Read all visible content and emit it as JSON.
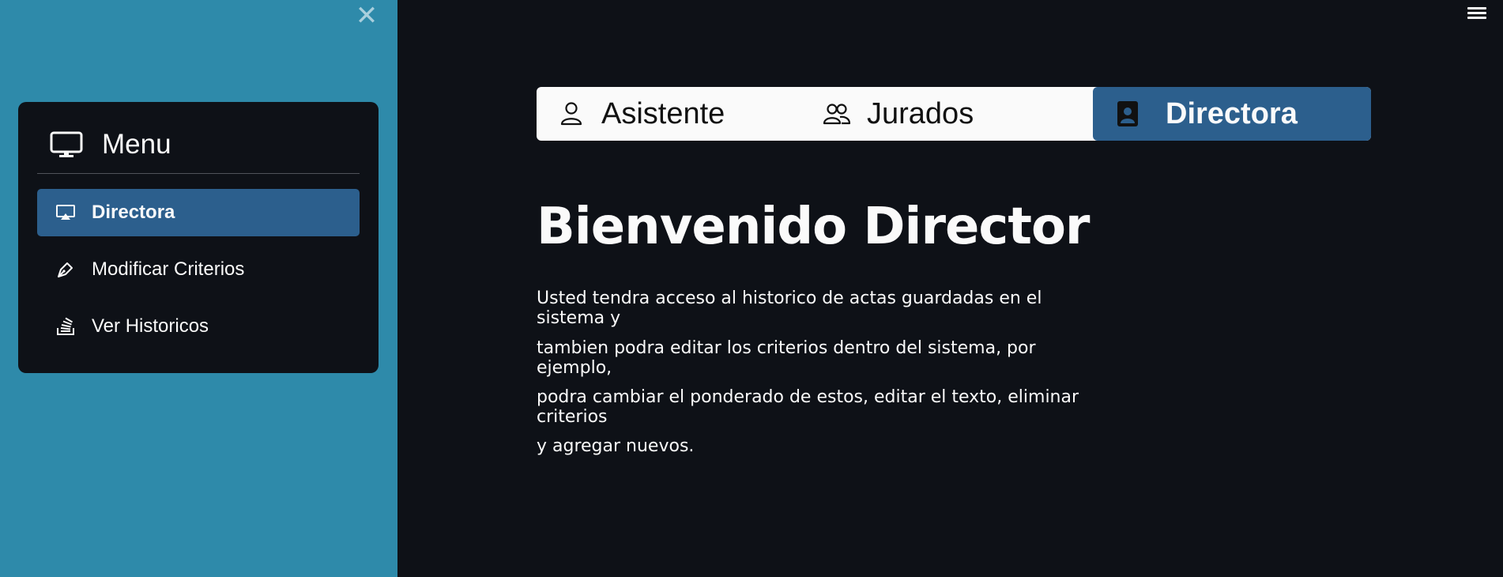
{
  "sidebar": {
    "close_label": "✕",
    "menu": {
      "title": "Menu",
      "icon": "monitor-icon",
      "items": [
        {
          "label": "Directora",
          "icon": "airplay-icon",
          "active": true
        },
        {
          "label": "Modificar Criterios",
          "icon": "pen-icon",
          "active": false
        },
        {
          "label": "Ver Historicos",
          "icon": "stack-icon",
          "active": false
        }
      ]
    }
  },
  "tabs": [
    {
      "label": "Asistente",
      "icon": "person-icon",
      "active": false
    },
    {
      "label": "Jurados",
      "icon": "people-icon",
      "active": false
    },
    {
      "label": "Directora",
      "icon": "person-badge-icon",
      "active": true
    }
  ],
  "main": {
    "title": "Bienvenido Director",
    "paragraph_lines": [
      "Usted tendra acceso al historico de actas guardadas en el sistema y",
      "tambien podra editar los criterios dentro del sistema, por ejemplo,",
      "podra cambiar el ponderado de estos, editar el texto, eliminar criterios",
      "y agregar nuevos."
    ]
  },
  "colors": {
    "sidebar_bg": "#2e8aaa",
    "main_bg": "#0e1117",
    "accent": "#2c5f8d",
    "text": "#fafafa"
  }
}
